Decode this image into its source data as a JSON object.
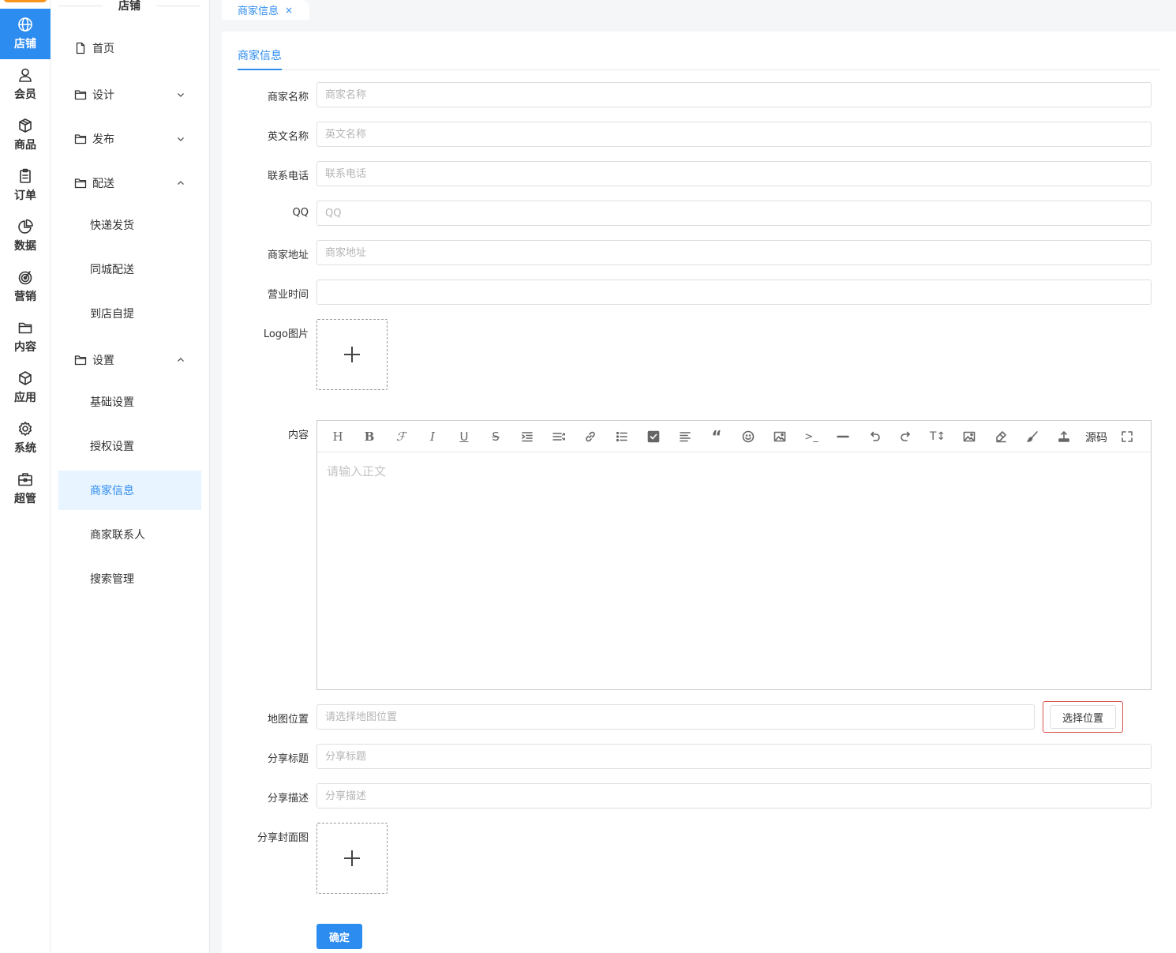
{
  "rail": {
    "items": [
      {
        "label": "店铺",
        "icon": "globe-icon",
        "active": true
      },
      {
        "label": "会员",
        "icon": "user-icon"
      },
      {
        "label": "商品",
        "icon": "box-icon"
      },
      {
        "label": "订单",
        "icon": "clipboard-icon"
      },
      {
        "label": "数据",
        "icon": "pie-chart-icon"
      },
      {
        "label": "营销",
        "icon": "target-icon"
      },
      {
        "label": "内容",
        "icon": "folder-icon"
      },
      {
        "label": "应用",
        "icon": "cube-icon"
      },
      {
        "label": "系统",
        "icon": "gear-icon"
      },
      {
        "label": "超管",
        "icon": "briefcase-icon"
      }
    ]
  },
  "menu": {
    "title": "店铺",
    "home": "首页",
    "design": "设计",
    "publish": "发布",
    "delivery": "配送",
    "delivery_items": [
      "快递发货",
      "同城配送",
      "到店自提"
    ],
    "settings": "设置",
    "settings_items": [
      "基础设置",
      "授权设置",
      "商家信息",
      "商家联系人",
      "搜索管理"
    ]
  },
  "tabs": {
    "open_tab": "商家信息",
    "close": "×"
  },
  "page": {
    "subtab": "商家信息"
  },
  "form": {
    "name": {
      "label": "商家名称",
      "placeholder": "商家名称",
      "value": ""
    },
    "en_name": {
      "label": "英文名称",
      "placeholder": "英文名称",
      "value": ""
    },
    "phone": {
      "label": "联系电话",
      "placeholder": "联系电话",
      "value": ""
    },
    "qq": {
      "label": "QQ",
      "placeholder": "QQ",
      "value": ""
    },
    "address": {
      "label": "商家地址",
      "placeholder": "商家地址",
      "value": ""
    },
    "hours": {
      "label": "营业时间",
      "placeholder": "",
      "value": ""
    },
    "logo": {
      "label": "Logo图片"
    },
    "content": {
      "label": "内容",
      "placeholder": "请输入正文",
      "source_label": "源码"
    },
    "map": {
      "label": "地图位置",
      "placeholder": "请选择地图位置",
      "button": "选择位置"
    },
    "share_title": {
      "label": "分享标题",
      "placeholder": "分享标题",
      "value": ""
    },
    "share_desc": {
      "label": "分享描述",
      "placeholder": "分享描述",
      "value": ""
    },
    "share_cover": {
      "label": "分享封面图"
    },
    "submit": "确定"
  },
  "colors": {
    "accent": "#2d8cf0",
    "brand": "#f7941d",
    "highlight_border": "#d9534f"
  }
}
